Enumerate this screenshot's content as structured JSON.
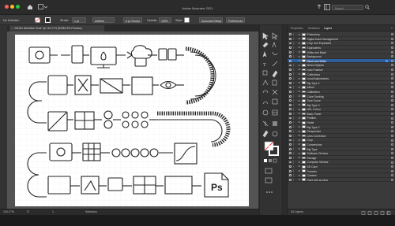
{
  "window": {
    "title": "Adobe Illustrator 2021",
    "search_placeholder": "Search"
  },
  "control_bar": {
    "selection_label": "No Selection",
    "stroke_label": "Stroke:",
    "stroke_value": "1 pt",
    "profile_value": "Uniform",
    "brush_value": "5 pt. Round",
    "opacity_label": "Opacity:",
    "opacity_value": "100%",
    "style_label": "Style:",
    "doc_setup_label": "Document Setup",
    "preferences_label": "Preferences"
  },
  "document_tab": {
    "label": "201102 Workflow 03.ai* @ 119.17% (RGB/CPU Preview)"
  },
  "status_bar": {
    "zoom": "119.17%",
    "angle": "0°",
    "artboard_number": "1",
    "tool_name": "Selection"
  },
  "layers_panel": {
    "tabs": [
      "Properties",
      "Swatches",
      "Layers"
    ],
    "active_tab": "Layers",
    "layers": [
      {
        "name": "Photoshop",
        "swatch": "#ffffff"
      },
      {
        "name": "Digital Asset Management",
        "swatch": "#ffffff"
      },
      {
        "name": "Crop Tool Expanded",
        "swatch": "#ffffff"
      },
      {
        "name": "Equivalents",
        "swatch": "#ffffff"
      },
      {
        "name": "White and Black",
        "swatch": "#ffffff"
      },
      {
        "name": "Background",
        "swatch": "#ffffff"
      },
      {
        "name": "Black and White",
        "swatch": "#ffffff"
      },
      {
        "name": "Mixed Objects",
        "swatch": "#ffffff"
      },
      {
        "name": "Auto Polarize",
        "swatch": "#ffffff"
      },
      {
        "name": "Collections",
        "swatch": "#ffffff"
      },
      {
        "name": "Local Adjustments",
        "swatch": "#ffffff"
      },
      {
        "name": "Big Type 4",
        "swatch": "#ffffff"
      },
      {
        "name": "Album",
        "swatch": "#ffffff"
      },
      {
        "name": "Calibration",
        "swatch": "#ffffff"
      },
      {
        "name": "Color Grading",
        "swatch": "#ffffff"
      },
      {
        "name": "Tone Curve",
        "swatch": "#ffffff"
      },
      {
        "name": "Big Type 3",
        "swatch": "#ffffff"
      },
      {
        "name": "HSL Colour",
        "swatch": "#ffffff"
      },
      {
        "name": "Basic Panel",
        "swatch": "#ffffff"
      },
      {
        "name": "Profiles",
        "swatch": "#ffffff"
      },
      {
        "name": "Detail",
        "swatch": "#ffffff"
      },
      {
        "name": "Big Type 2",
        "swatch": "#ffffff"
      },
      {
        "name": "Perspective",
        "swatch": "#ffffff"
      },
      {
        "name": "Lens Correction",
        "swatch": "#ffffff"
      },
      {
        "name": "Crop",
        "swatch": "#ffffff"
      },
      {
        "name": "Conversions",
        "swatch": "#ffffff"
      },
      {
        "name": "Big Type",
        "swatch": "#ffffff"
      },
      {
        "name": "Software Choices",
        "swatch": "#ffffff"
      },
      {
        "name": "Storage",
        "swatch": "#ffffff"
      },
      {
        "name": "Computer Monitor",
        "swatch": "#ffffff"
      },
      {
        "name": "SD Card",
        "swatch": "#ffffff"
      },
      {
        "name": "Transfer",
        "swatch": "#ffffff"
      },
      {
        "name": "Camera",
        "swatch": "#ffffff"
      },
      {
        "name": "Start with an Idea",
        "swatch": "#ffffff"
      }
    ],
    "selected_index": 6,
    "footer_count": "34 Layers"
  },
  "artboard": {
    "ps_label": "Ps"
  },
  "colors": {
    "accent": "#2f5f9a",
    "selection_blue": "#4b8df8",
    "close": "#ff5f57",
    "minimize": "#febc2e",
    "zoom": "#28c840"
  }
}
